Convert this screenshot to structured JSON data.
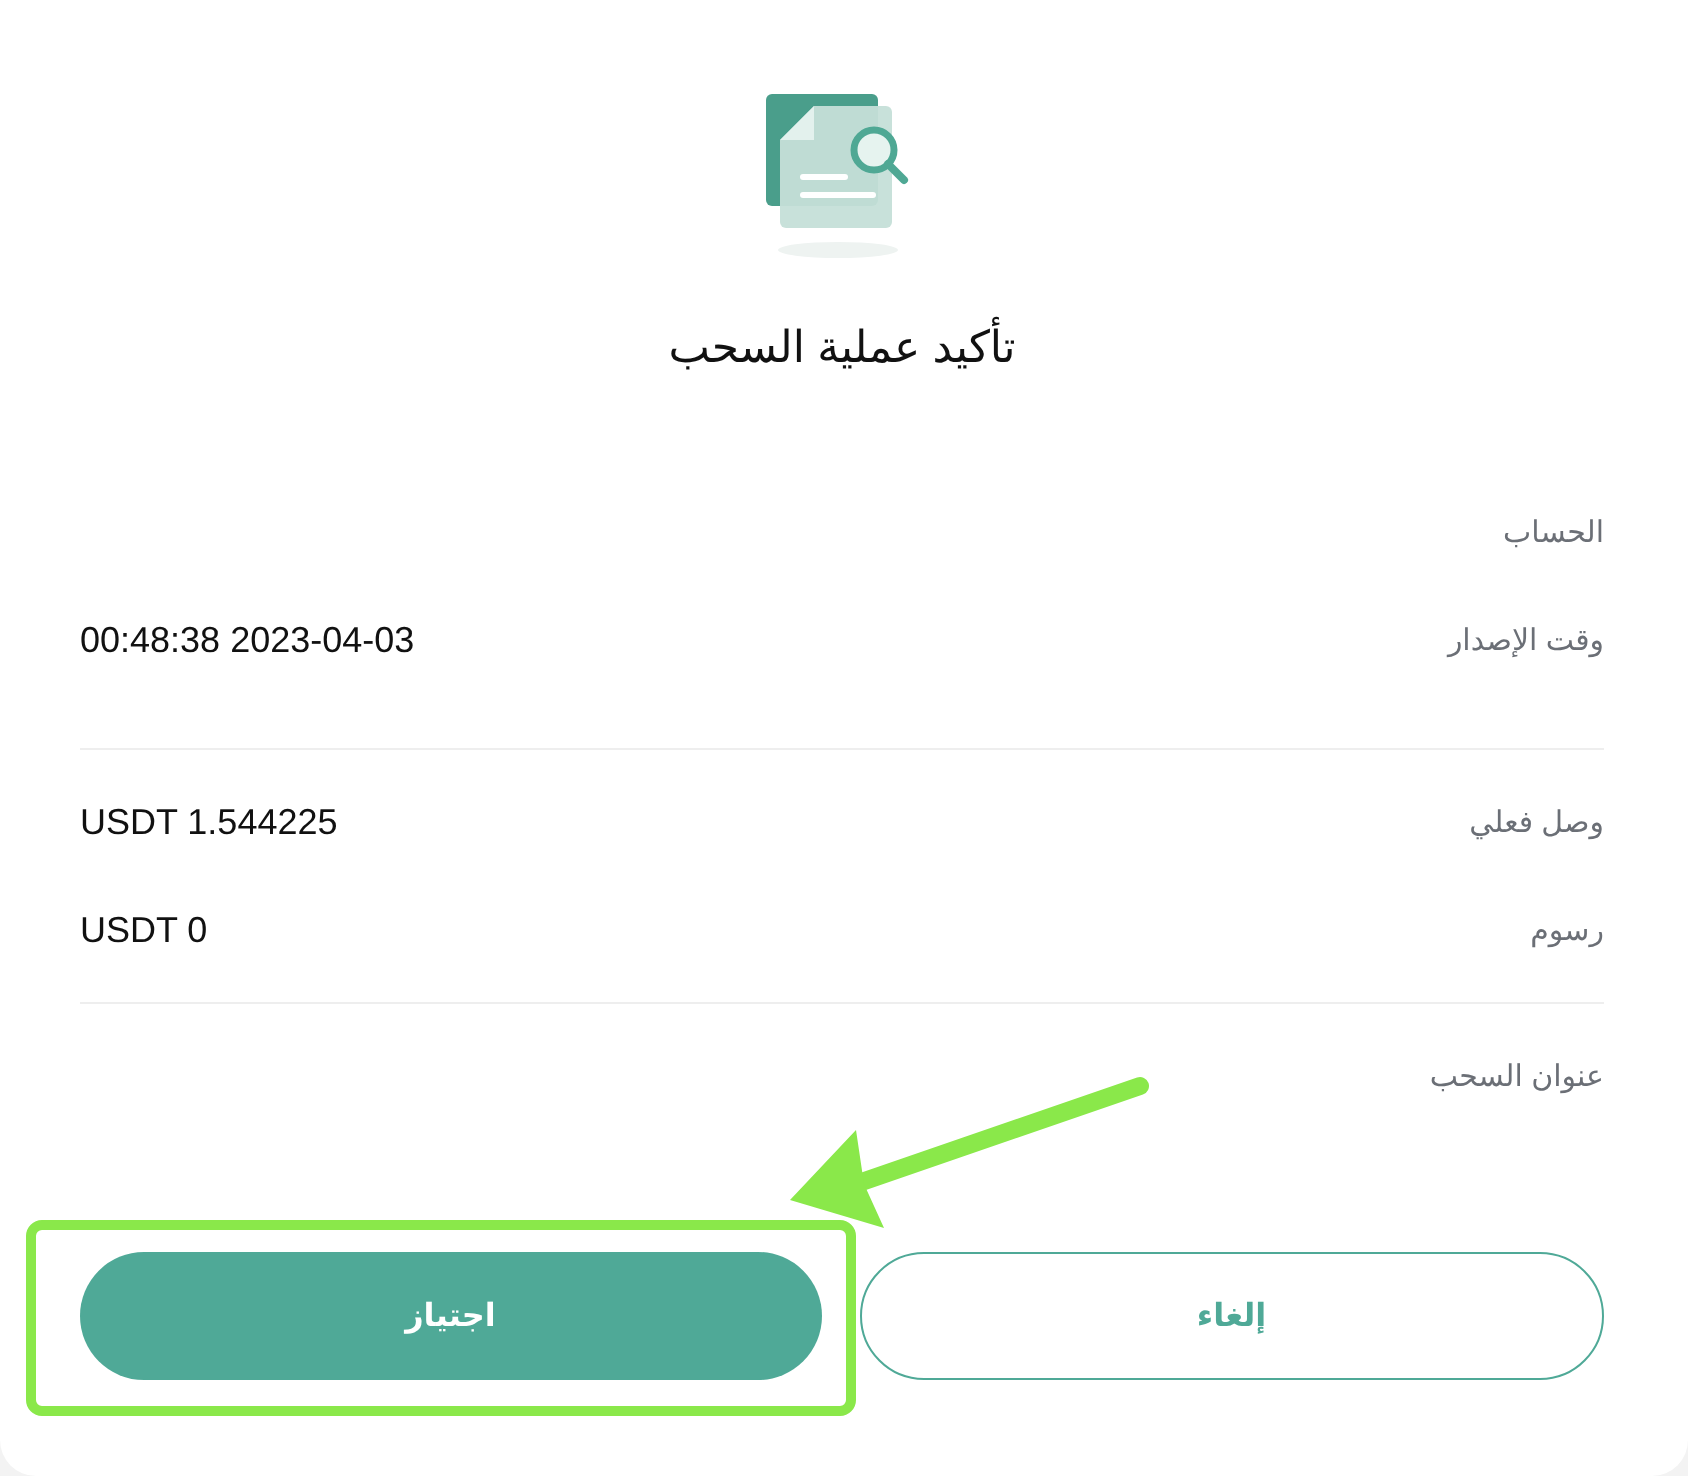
{
  "dialog": {
    "title": "تأكيد عملية السحب",
    "sections": [
      [
        {
          "label": "الحساب"
        },
        {
          "label": "وقت الإصدار",
          "value": "00:48:38 2023-04-03"
        }
      ],
      [
        {
          "label": "وصل فعلي",
          "value": "USDT 1.544225"
        },
        {
          "label": "رسوم",
          "value": "USDT 0"
        }
      ],
      [
        {
          "label": "عنوان السحب"
        }
      ]
    ],
    "buttons": [
      {
        "label": "إلغاء",
        "kind": "outline"
      },
      {
        "label": "اجتياز",
        "kind": "primary"
      }
    ]
  }
}
